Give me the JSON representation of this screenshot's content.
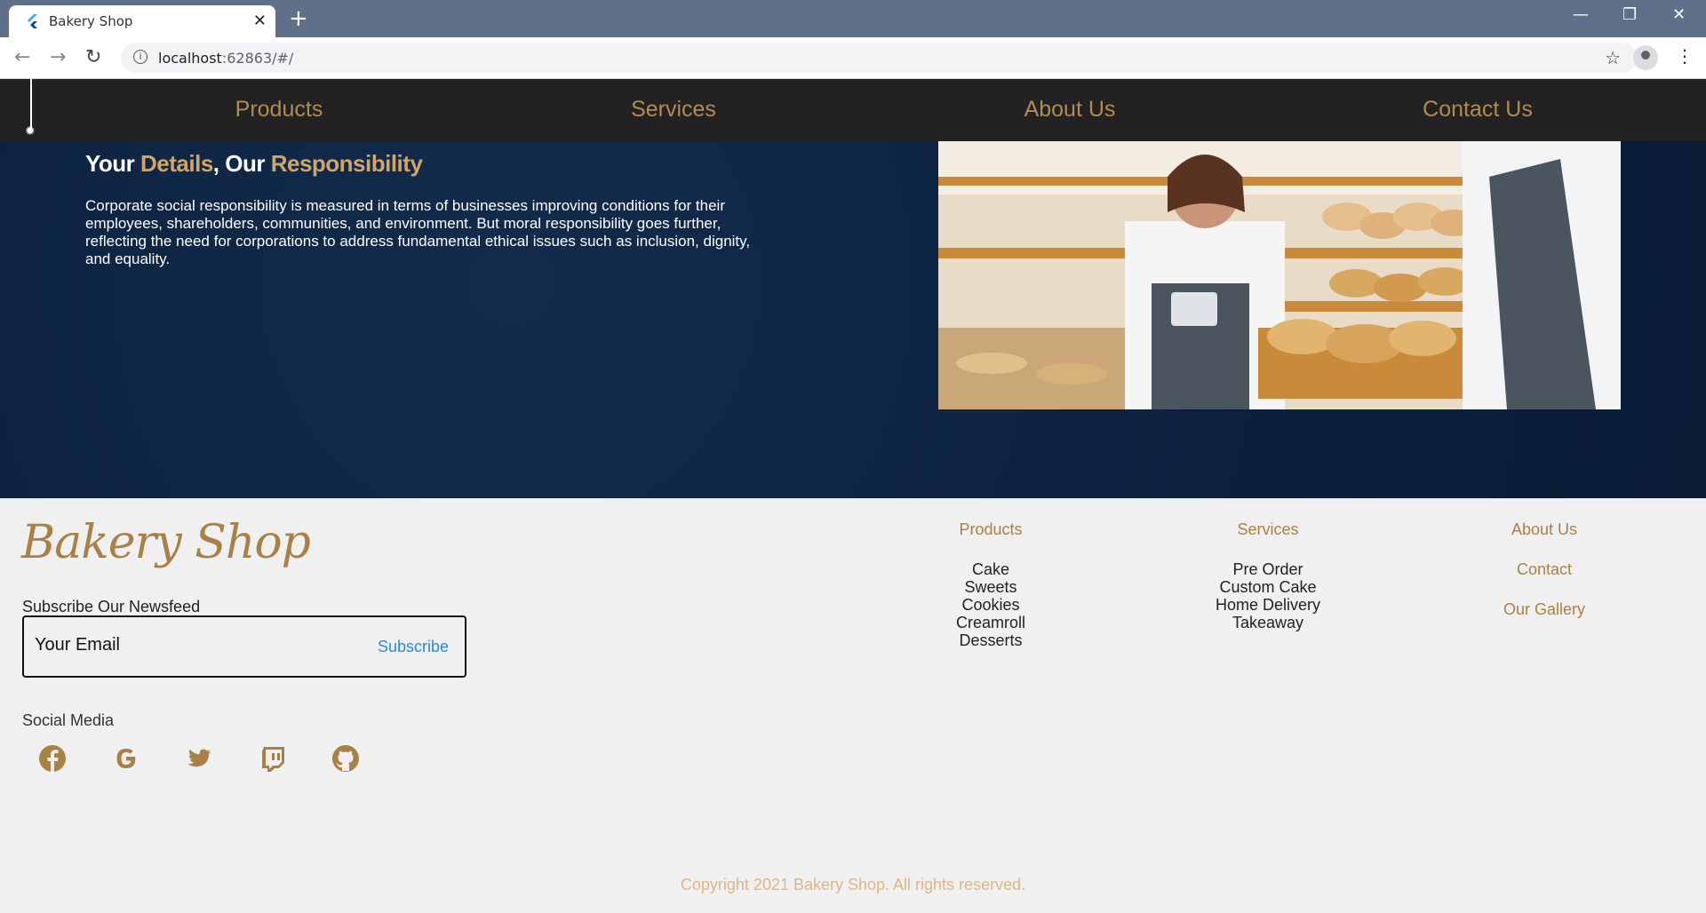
{
  "browser": {
    "tab_title": "Bakery Shop",
    "url_host": "localhost",
    "url_rest": ":62863/#/"
  },
  "nav": {
    "items": [
      "Products",
      "Services",
      "About Us",
      "Contact Us"
    ]
  },
  "hero": {
    "title_parts": [
      "Your ",
      "Details",
      ", Our ",
      "Responsibility"
    ],
    "text": "Corporate social responsibility is measured in terms of businesses improving conditions for their employees, shareholders, communities, and environment. But moral responsibility goes further, reflecting the need for corporations to address fundamental ethical issues such as inclusion, dignity, and equality."
  },
  "footer": {
    "logo": "Bakery Shop",
    "subscribe_label": "Subscribe Our Newsfeed",
    "email_placeholder": "Your Email",
    "subscribe_button": "Subscribe",
    "social_label": "Social Media",
    "social_icons": [
      "facebook-icon",
      "google-icon",
      "twitter-icon",
      "twitch-icon",
      "github-icon"
    ],
    "products": {
      "title": "Products",
      "items": [
        "Cake",
        "Sweets",
        "Cookies",
        "Creamroll",
        "Desserts"
      ]
    },
    "services": {
      "title": "Services",
      "items": [
        "Pre Order",
        "Custom Cake",
        "Home Delivery",
        "Takeaway"
      ]
    },
    "about": {
      "links": [
        "About Us",
        "Contact",
        "Our Gallery"
      ]
    },
    "copyright": "Copyright 2021 Bakery Shop. All rights reserved."
  },
  "colors": {
    "accent": "#a98146",
    "nav_bg": "#222222",
    "hero_bg": "#0d2240",
    "footer_bg": "#f0f0f0",
    "link_blue": "#2a8ad6"
  }
}
